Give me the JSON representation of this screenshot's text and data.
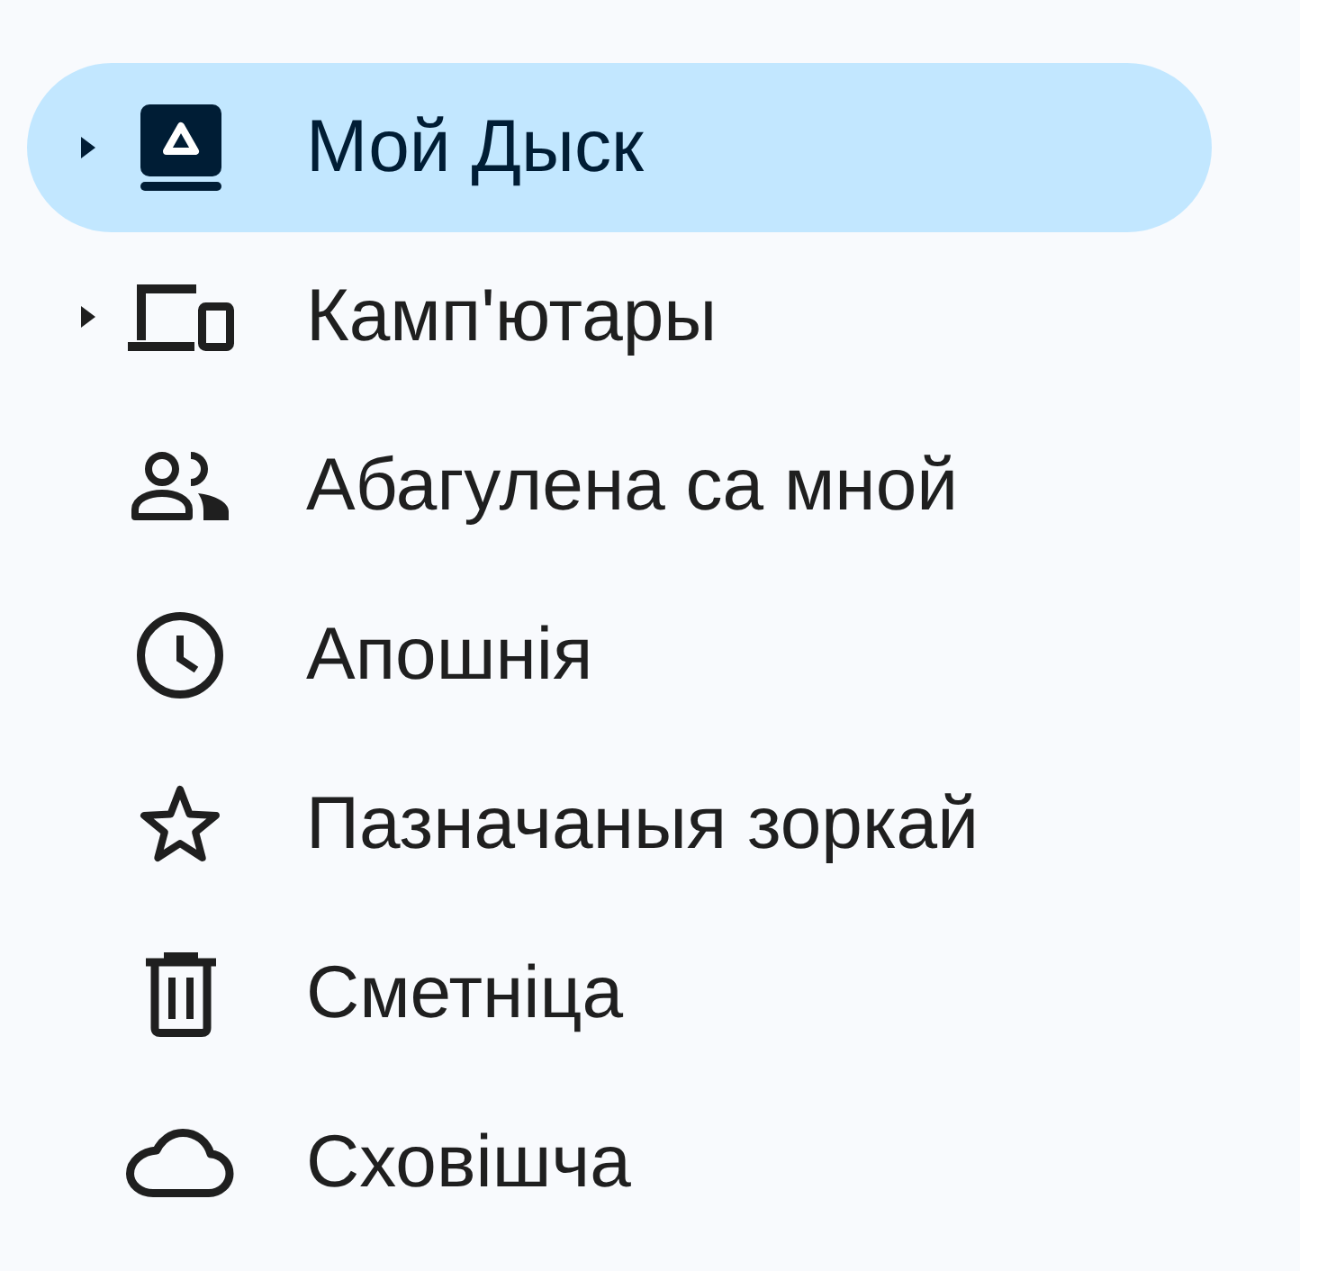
{
  "sidebar": {
    "items": [
      {
        "label": "Мой Дыск",
        "selected": true,
        "expanded": false
      },
      {
        "label": "Камп'ютары",
        "selected": false,
        "expanded": false
      },
      {
        "label": "Абагулена са мной",
        "selected": false
      },
      {
        "label": "Апошнія",
        "selected": false
      },
      {
        "label": "Пазначаныя зоркай",
        "selected": false
      },
      {
        "label": "Сметніца",
        "selected": false
      },
      {
        "label": "Сховішча",
        "selected": false
      }
    ]
  }
}
